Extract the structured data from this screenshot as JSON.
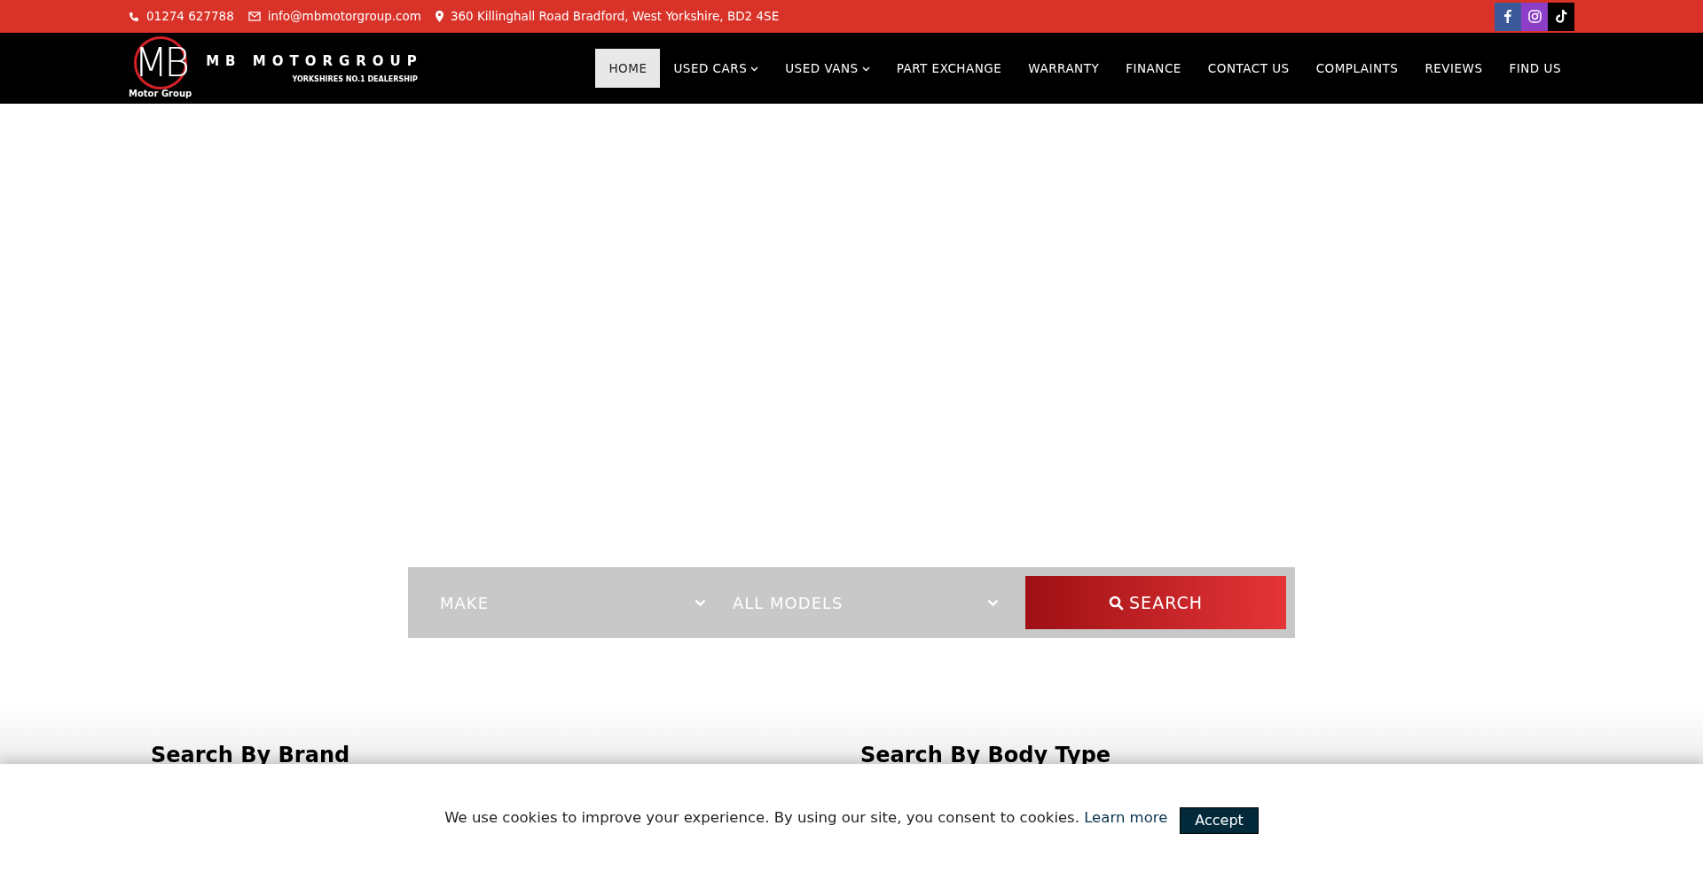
{
  "topbar": {
    "phone": "01274 627788",
    "email": "info@mbmotorgroup.com",
    "address": "360 Killinghall Road Bradford, West Yorkshire, BD2 4SE",
    "social": [
      {
        "kind": "facebook"
      },
      {
        "kind": "instagram"
      },
      {
        "kind": "tiktok"
      }
    ]
  },
  "logo": {
    "monogram": "MB",
    "subtitle": "Motor Group",
    "name": "MB MOTORGROUP",
    "tagline": "YORKSHIRES NO.1 DEALERSHIP"
  },
  "nav": [
    {
      "label": "HOME",
      "selected": true,
      "dropdown": false
    },
    {
      "label": "USED CARS",
      "selected": false,
      "dropdown": true
    },
    {
      "label": "USED VANS",
      "selected": false,
      "dropdown": true
    },
    {
      "label": "PART EXCHANGE",
      "selected": false,
      "dropdown": false
    },
    {
      "label": "WARRANTY",
      "selected": false,
      "dropdown": false
    },
    {
      "label": "FINANCE",
      "selected": false,
      "dropdown": false
    },
    {
      "label": "CONTACT US",
      "selected": false,
      "dropdown": false
    },
    {
      "label": "COMPLAINTS",
      "selected": false,
      "dropdown": false
    },
    {
      "label": "REVIEWS",
      "selected": false,
      "dropdown": false
    },
    {
      "label": "FIND US",
      "selected": false,
      "dropdown": false
    }
  ],
  "search": {
    "make": "MAKE",
    "model": "ALL MODELS",
    "button": "SEARCH"
  },
  "sections": [
    "Search By Brand",
    "Search By Body Type"
  ],
  "cookie": {
    "text": "We use cookies to improve your experience. By using our site, you consent to cookies.",
    "link": "Learn more",
    "button": "Accept"
  }
}
